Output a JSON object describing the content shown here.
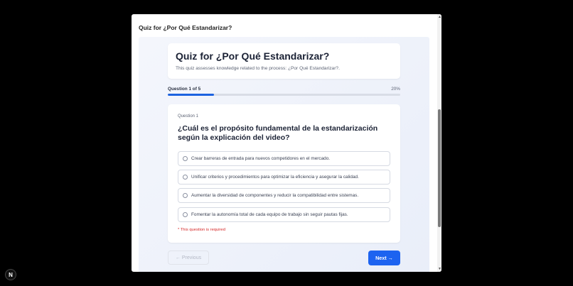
{
  "modal": {
    "title": "Quiz for ¿Por Qué Estandarizar?"
  },
  "header": {
    "title": "Quiz for ¿Por Qué Estandarizar?",
    "description": "This quiz assesses knowledge related to the process: ¿Por Qué Estandarizar?."
  },
  "progress": {
    "label": "Question 1 of 5",
    "percent_label": "20%",
    "percent": 20
  },
  "question": {
    "number_label": "Question 1",
    "text": "¿Cuál es el propósito fundamental de la estandarización según la explicación del video?",
    "options": [
      "Crear barreras de entrada para nuevos competidores en el mercado.",
      "Unificar criterios y procedimientos para optimizar la eficiencia y asegurar la calidad.",
      "Aumentar la diversidad de componentes y reducir la compatibilidad entre sistemas.",
      "Fomentar la autonomía total de cada equipo de trabajo sin seguir pautas fijas."
    ],
    "error": "* This question is required"
  },
  "nav": {
    "previous_label": "← Previous",
    "next_label": "Next →"
  },
  "badge": {
    "label": "N"
  },
  "scrollbar": {
    "up_glyph": "▲",
    "down_glyph": "▼"
  },
  "colors": {
    "accent": "#1d63f0",
    "progress_fill": "#1d63e0",
    "error": "#d62828"
  }
}
